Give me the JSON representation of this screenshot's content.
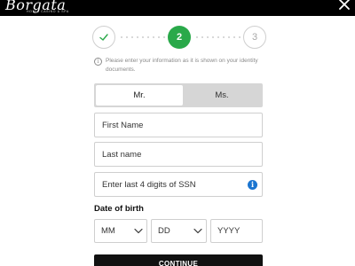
{
  "header": {
    "logo_text": "Borgata",
    "logo_subtext": "HOTEL CASINO & SPA",
    "close_icon": "close-icon"
  },
  "stepper": {
    "steps": [
      {
        "label": "✓",
        "state": "completed"
      },
      {
        "label": "2",
        "state": "active"
      },
      {
        "label": "3",
        "state": "upcoming"
      }
    ],
    "active_color": "#2aa94a"
  },
  "info_note": {
    "text": "Please enter your information as it is shown on your identity documents.",
    "icon": "info-icon"
  },
  "gender": {
    "options": [
      "Mr.",
      "Ms."
    ],
    "selected": "Mr."
  },
  "form": {
    "first_name_placeholder": "First Name",
    "last_name_placeholder": "Last name",
    "ssn_placeholder": "Enter last 4 digits of SSN",
    "ssn_info_icon": "info-icon",
    "info_color": "#1b75d0"
  },
  "dob": {
    "label": "Date of birth",
    "month_placeholder": "MM",
    "day_placeholder": "DD",
    "year_placeholder": "YYYY"
  },
  "continue_label": "CONTINUE"
}
